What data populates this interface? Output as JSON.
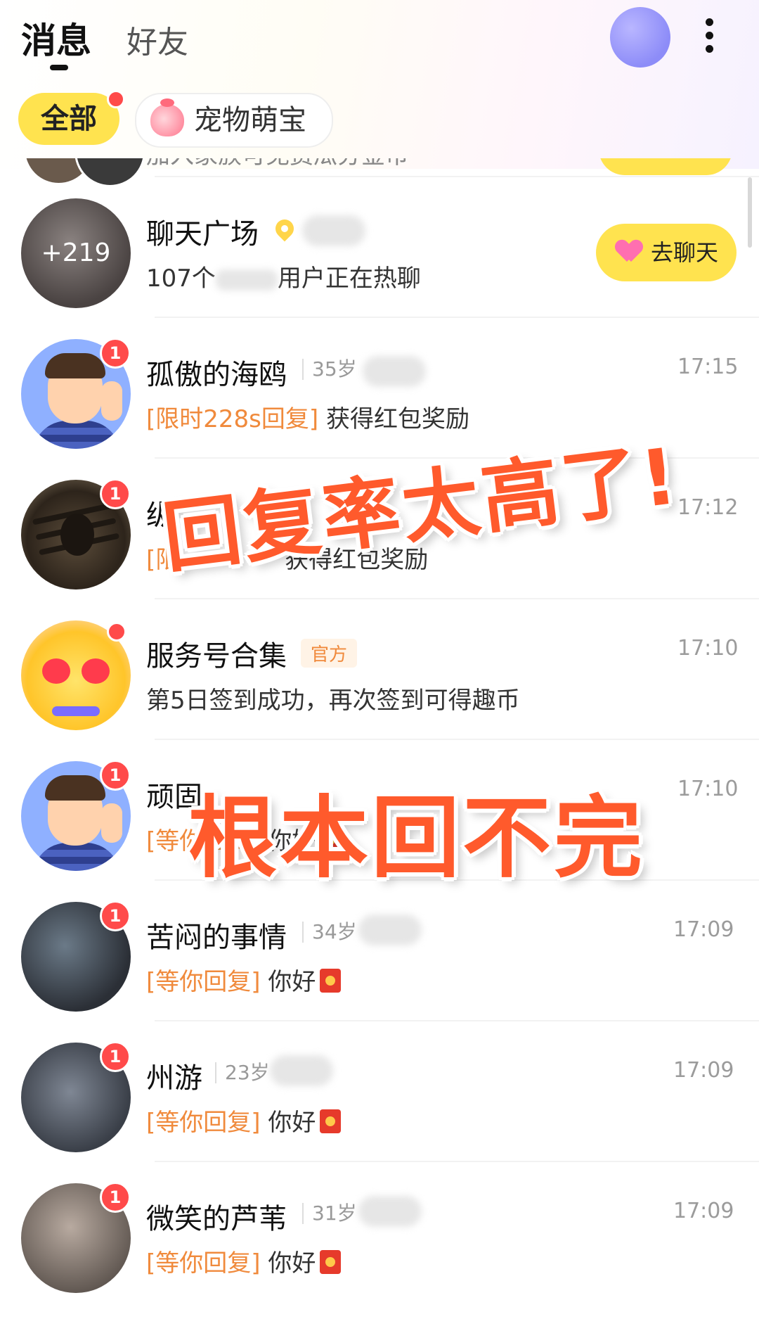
{
  "header": {
    "tabs": [
      {
        "label": "消息",
        "active": true
      },
      {
        "label": "好友",
        "active": false
      }
    ]
  },
  "filters": [
    {
      "label": "全部",
      "active": true,
      "has_dot": true
    },
    {
      "label": "宠物萌宝",
      "active": false,
      "icon": "peach-mascot-icon"
    }
  ],
  "partial_row": {
    "subtitle": "加入家族可免费瓜分金币"
  },
  "plaza": {
    "name": "聊天广场",
    "avatar_count": "+219",
    "subtitle_prefix": "107个",
    "subtitle_suffix": "用户正在热聊",
    "button_label": "去聊天"
  },
  "conversations": [
    {
      "name": "孤傲的海鸥",
      "age": "35岁",
      "time": "17:15",
      "badge": "1",
      "tag": "[限时228s回复]",
      "message": "获得红包奖励",
      "red_packet": false,
      "avatar": "cartoon-man"
    },
    {
      "name": "纵",
      "age": "",
      "time": "17:12",
      "badge": "1",
      "tag": "[限",
      "message": "获得红包奖励",
      "red_packet": false,
      "avatar": "spider"
    },
    {
      "name": "服务号合集",
      "official_label": "官方",
      "age": "",
      "time": "17:10",
      "badge": "",
      "tag": "",
      "message": "第5日签到成功，再次签到可得趣币",
      "red_packet": false,
      "avatar": "mascot"
    },
    {
      "name": "顽固",
      "age": "",
      "time": "17:10",
      "badge": "1",
      "tag": "[等你回复]",
      "message": "你好",
      "red_packet": true,
      "avatar": "cartoon-man"
    },
    {
      "name": "苦闷的事情",
      "age": "34岁",
      "time": "17:09",
      "badge": "1",
      "tag": "[等你回复]",
      "message": "你好",
      "red_packet": true,
      "avatar": "photo1"
    },
    {
      "name": "州游",
      "age": "23岁",
      "time": "17:09",
      "badge": "1",
      "tag": "[等你回复]",
      "message": "你好",
      "red_packet": true,
      "avatar": "photo2"
    },
    {
      "name": "微笑的芦苇",
      "age": "31岁",
      "time": "17:09",
      "badge": "1",
      "tag": "[等你回复]",
      "message": "你好",
      "red_packet": true,
      "avatar": "photo3"
    }
  ],
  "overlay": {
    "line1": "回复率太高了!",
    "line2": "根本回不完",
    "color": "#ff5a2c"
  },
  "colors": {
    "accent_yellow": "#ffe34f",
    "badge_red": "#ff4a4a",
    "tag_orange": "#f08a3c"
  }
}
